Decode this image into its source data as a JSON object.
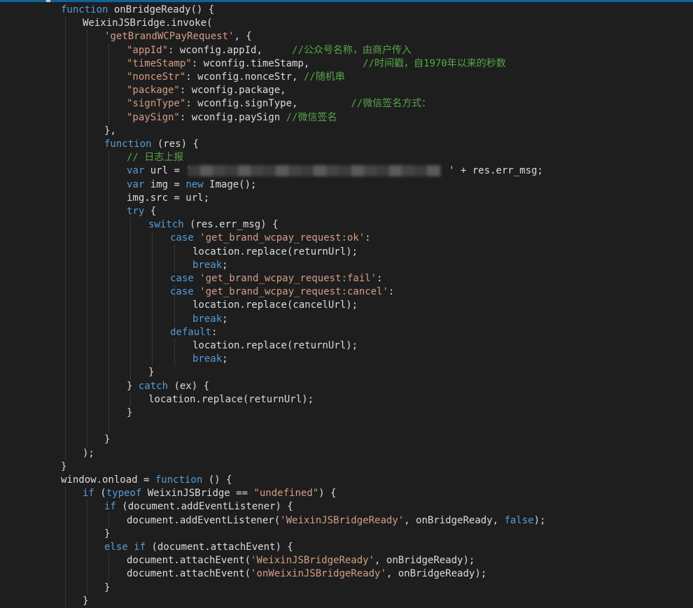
{
  "editor": {
    "lines": [
      [
        {
          "t": "kw",
          "v": "function"
        },
        {
          "t": "plain",
          "v": " onBridgeReady() {"
        }
      ],
      [
        {
          "t": "plain",
          "v": "WeixinJSBridge.invoke("
        }
      ],
      [
        {
          "t": "str",
          "v": "'getBrandWCPayRequest'"
        },
        {
          "t": "plain",
          "v": ", {"
        }
      ],
      [
        {
          "t": "str",
          "v": "\"appId\""
        },
        {
          "t": "plain",
          "v": ": wconfig.appId,     "
        },
        {
          "t": "com",
          "v": "//公众号名称，由商户传入"
        }
      ],
      [
        {
          "t": "str",
          "v": "\"timeStamp\""
        },
        {
          "t": "plain",
          "v": ": wconfig.timeStamp,         "
        },
        {
          "t": "com",
          "v": "//时间戳，自1970年以来的秒数"
        }
      ],
      [
        {
          "t": "str",
          "v": "\"nonceStr\""
        },
        {
          "t": "plain",
          "v": ": wconfig.nonceStr, "
        },
        {
          "t": "com",
          "v": "//随机串"
        }
      ],
      [
        {
          "t": "str",
          "v": "\"package\""
        },
        {
          "t": "plain",
          "v": ": wconfig.package,"
        }
      ],
      [
        {
          "t": "str",
          "v": "\"signType\""
        },
        {
          "t": "plain",
          "v": ": wconfig.signType,         "
        },
        {
          "t": "com",
          "v": "//微信签名方式："
        }
      ],
      [
        {
          "t": "str",
          "v": "\"paySign\""
        },
        {
          "t": "plain",
          "v": ": wconfig.paySign "
        },
        {
          "t": "com",
          "v": "//微信签名"
        }
      ],
      [
        {
          "t": "plain",
          "v": "},"
        }
      ],
      [
        {
          "t": "kw",
          "v": "function"
        },
        {
          "t": "plain",
          "v": " (res) {"
        }
      ],
      [
        {
          "t": "com",
          "v": "// 日志上报"
        }
      ],
      [
        {
          "t": "kw",
          "v": "var"
        },
        {
          "t": "plain",
          "v": " url = "
        },
        {
          "t": "str",
          "v": "'"
        }
      ],
      [
        {
          "t": "kw",
          "v": "var"
        },
        {
          "t": "plain",
          "v": " img = "
        },
        {
          "t": "kw",
          "v": "new"
        },
        {
          "t": "plain",
          "v": " Image();"
        }
      ],
      [
        {
          "t": "plain",
          "v": "img.src = url;"
        }
      ],
      [
        {
          "t": "kw",
          "v": "try"
        },
        {
          "t": "plain",
          "v": " {"
        }
      ],
      [
        {
          "t": "kw",
          "v": "switch"
        },
        {
          "t": "plain",
          "v": " (res.err_msg) {"
        }
      ],
      [
        {
          "t": "kw",
          "v": "case"
        },
        {
          "t": "plain",
          "v": " "
        },
        {
          "t": "str",
          "v": "'get_brand_wcpay_request:ok'"
        },
        {
          "t": "plain",
          "v": ":"
        }
      ],
      [
        {
          "t": "plain",
          "v": "location.replace(returnUrl);"
        }
      ],
      [
        {
          "t": "kw",
          "v": "break"
        },
        {
          "t": "plain",
          "v": ";"
        }
      ],
      [
        {
          "t": "kw",
          "v": "case"
        },
        {
          "t": "plain",
          "v": " "
        },
        {
          "t": "str",
          "v": "'get_brand_wcpay_request:fail'"
        },
        {
          "t": "plain",
          "v": ":"
        }
      ],
      [
        {
          "t": "kw",
          "v": "case"
        },
        {
          "t": "plain",
          "v": " "
        },
        {
          "t": "str",
          "v": "'get_brand_wcpay_request:cancel'"
        },
        {
          "t": "plain",
          "v": ":"
        }
      ],
      [
        {
          "t": "plain",
          "v": "location.replace(cancelUrl);"
        }
      ],
      [
        {
          "t": "kw",
          "v": "break"
        },
        {
          "t": "plain",
          "v": ";"
        }
      ],
      [
        {
          "t": "kw",
          "v": "default"
        },
        {
          "t": "plain",
          "v": ":"
        }
      ],
      [
        {
          "t": "plain",
          "v": "location.replace(returnUrl);"
        }
      ],
      [
        {
          "t": "kw",
          "v": "break"
        },
        {
          "t": "plain",
          "v": ";"
        }
      ],
      [
        {
          "t": "plain",
          "v": "}"
        }
      ],
      [
        {
          "t": "plain",
          "v": "} "
        },
        {
          "t": "kw",
          "v": "catch"
        },
        {
          "t": "plain",
          "v": " (ex) {"
        }
      ],
      [
        {
          "t": "plain",
          "v": "location.replace(returnUrl);"
        }
      ],
      [
        {
          "t": "plain",
          "v": "}"
        }
      ],
      [],
      [
        {
          "t": "plain",
          "v": "}"
        }
      ],
      [
        {
          "t": "plain",
          "v": ");"
        }
      ],
      [
        {
          "t": "plain",
          "v": "}"
        }
      ],
      [
        {
          "t": "plain",
          "v": "window.onload = "
        },
        {
          "t": "kw",
          "v": "function"
        },
        {
          "t": "plain",
          "v": " () {"
        }
      ],
      [
        {
          "t": "kw",
          "v": "if"
        },
        {
          "t": "plain",
          "v": " ("
        },
        {
          "t": "kw",
          "v": "typeof"
        },
        {
          "t": "plain",
          "v": " WeixinJSBridge == "
        },
        {
          "t": "str",
          "v": "\"undefined\""
        },
        {
          "t": "plain",
          "v": ") {"
        }
      ],
      [
        {
          "t": "kw",
          "v": "if"
        },
        {
          "t": "plain",
          "v": " (document.addEventListener) {"
        }
      ],
      [
        {
          "t": "plain",
          "v": "document.addEventListener("
        },
        {
          "t": "str",
          "v": "'WeixinJSBridgeReady'"
        },
        {
          "t": "plain",
          "v": ", onBridgeReady, "
        },
        {
          "t": "kw",
          "v": "false"
        },
        {
          "t": "plain",
          "v": ");"
        }
      ],
      [
        {
          "t": "plain",
          "v": "}"
        }
      ],
      [
        {
          "t": "kw",
          "v": "else if"
        },
        {
          "t": "plain",
          "v": " (document.attachEvent) {"
        }
      ],
      [
        {
          "t": "plain",
          "v": "document.attachEvent("
        },
        {
          "t": "str",
          "v": "'WeixinJSBridgeReady'"
        },
        {
          "t": "plain",
          "v": ", onBridgeReady);"
        }
      ],
      [
        {
          "t": "plain",
          "v": "document.attachEvent("
        },
        {
          "t": "str",
          "v": "'onWeixinJSBridgeReady'"
        },
        {
          "t": "plain",
          "v": ", onBridgeReady);"
        }
      ],
      [
        {
          "t": "plain",
          "v": "}"
        }
      ],
      [
        {
          "t": "plain",
          "v": "}"
        }
      ]
    ],
    "url_tail": "' + res.err_msg;"
  },
  "colors": {
    "background": "#1e1e1e",
    "keyword": "#569cd6",
    "string": "#d69d85",
    "comment": "#57a64a",
    "text": "#dcdcdc"
  }
}
